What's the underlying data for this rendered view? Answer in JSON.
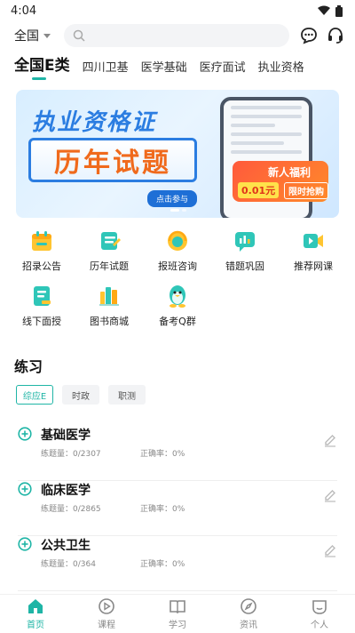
{
  "status_bar": {
    "time": "4:04"
  },
  "top_bar": {
    "region": "全国",
    "search_placeholder": ""
  },
  "category_tabs": [
    {
      "label": "全国E类",
      "active": true
    },
    {
      "label": "四川卫基",
      "active": false
    },
    {
      "label": "医学基础",
      "active": false
    },
    {
      "label": "医疗面试",
      "active": false
    },
    {
      "label": "执业资格",
      "active": false
    }
  ],
  "banner": {
    "title_line1": "执业资格证",
    "title_line2": "历年试题",
    "button": "点击参与",
    "promo_title": "新人福利",
    "promo_price": "0.01元",
    "promo_tag": "限时抢购"
  },
  "shortcuts": [
    {
      "label": "招录公告",
      "icon": "calendar-icon"
    },
    {
      "label": "历年试题",
      "icon": "scroll-icon"
    },
    {
      "label": "报班咨询",
      "icon": "headset-icon"
    },
    {
      "label": "错题巩固",
      "icon": "chart-chat-icon"
    },
    {
      "label": "推荐网课",
      "icon": "video-icon"
    },
    {
      "label": "线下面授",
      "icon": "notebook-icon"
    },
    {
      "label": "图书商城",
      "icon": "books-icon"
    },
    {
      "label": "备考Q群",
      "icon": "penguin-icon"
    }
  ],
  "practice": {
    "title": "练习",
    "tabs": [
      {
        "label": "综应E",
        "active": true
      },
      {
        "label": "时政",
        "active": false
      },
      {
        "label": "职测",
        "active": false
      }
    ],
    "items": [
      {
        "name": "基础医学",
        "count": "练题量：0/2307",
        "accuracy": "正确率：0%"
      },
      {
        "name": "临床医学",
        "count": "练题量：0/2865",
        "accuracy": "正确率：0%"
      },
      {
        "name": "公共卫生",
        "count": "练题量：0/364",
        "accuracy": "正确率：0%"
      }
    ]
  },
  "bottom_nav": [
    {
      "label": "首页",
      "icon": "home-icon",
      "active": true
    },
    {
      "label": "课程",
      "icon": "play-icon",
      "active": false
    },
    {
      "label": "学习",
      "icon": "book-icon",
      "active": false
    },
    {
      "label": "资讯",
      "icon": "compass-icon",
      "active": false
    },
    {
      "label": "个人",
      "icon": "profile-icon",
      "active": false
    }
  ],
  "colors": {
    "accent": "#1fb5a6",
    "banner_blue": "#2b7de1",
    "promo_orange": "#ff5a3c"
  }
}
